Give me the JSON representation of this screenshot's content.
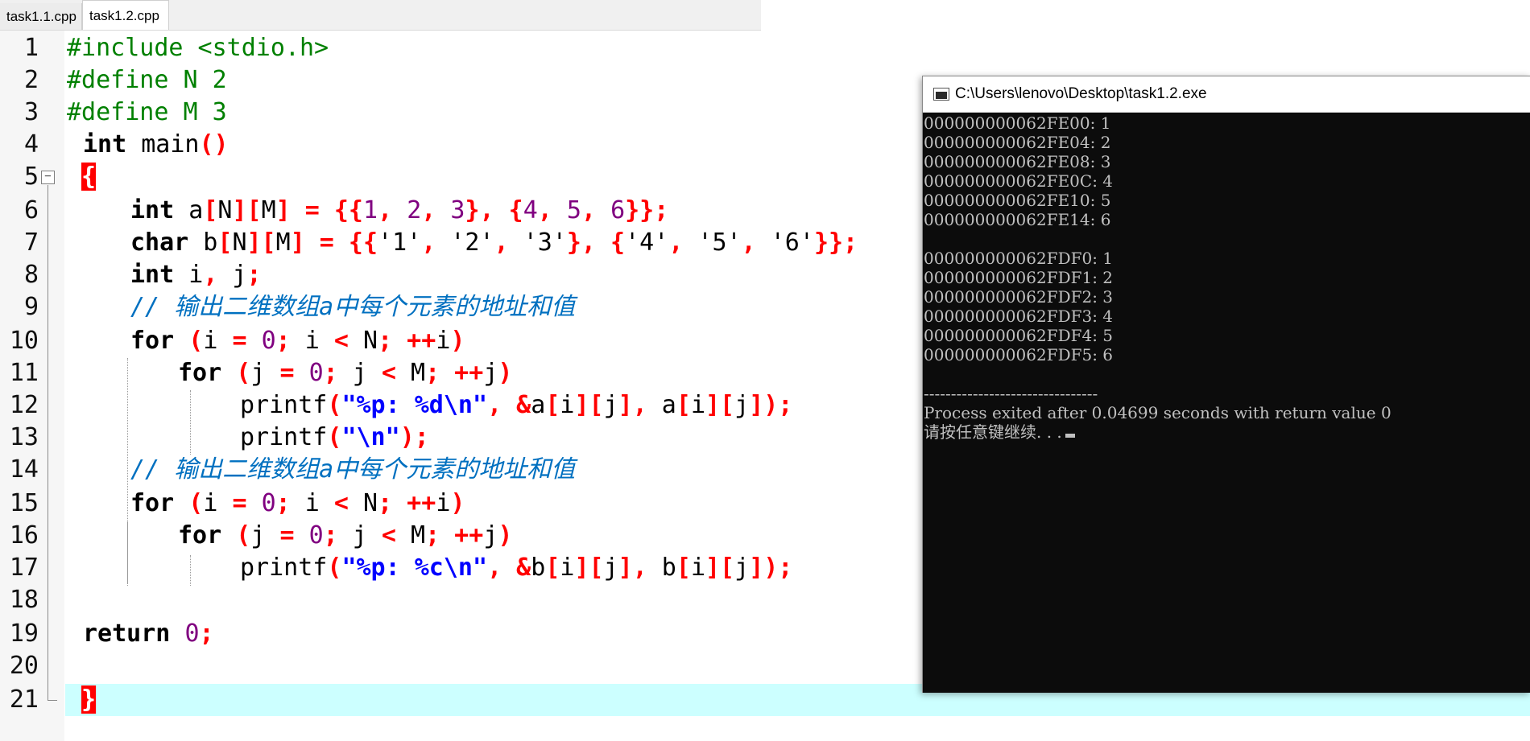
{
  "tabs": [
    {
      "label": "task1.1.cpp",
      "active": false
    },
    {
      "label": "task1.2.cpp",
      "active": true
    }
  ],
  "line_numbers": [
    "1",
    "2",
    "3",
    "4",
    "5",
    "6",
    "7",
    "8",
    "9",
    "10",
    "11",
    "12",
    "13",
    "14",
    "15",
    "16",
    "17",
    "18",
    "19",
    "20",
    "21"
  ],
  "code": {
    "l1_pp": "#include <stdio.h>",
    "l2_pp": "#define N 2",
    "l3_pp": "#define M 3",
    "l4_kw": "int",
    "l4_name": " main",
    "l4_paren": "()",
    "brace_open": "{",
    "l6_kw": "int",
    "l6_a": " a",
    "l6_b1": "[",
    "l6_n": "N",
    "l6_b2": "][",
    "l6_m": "M",
    "l6_b3": "]",
    "l6_eq": " = {{",
    "l6_v1": "1",
    "l6_c1": ", ",
    "l6_v2": "2",
    "l6_c2": ", ",
    "l6_v3": "3",
    "l6_mid": "}, {",
    "l6_v4": "4",
    "l6_c3": ", ",
    "l6_v5": "5",
    "l6_c4": ", ",
    "l6_v6": "6",
    "l6_end": "}};",
    "l7_kw": "char",
    "l7_b": " b",
    "l7_s1": "[",
    "l7_n": "N",
    "l7_s2": "][",
    "l7_m": "M",
    "l7_s3": "]",
    "l7_eq": " = {{",
    "l7_v1": "'1'",
    "l7_c1": ", ",
    "l7_v2": "'2'",
    "l7_c2": ", ",
    "l7_v3": "'3'",
    "l7_mid": "}, {",
    "l7_v4": "'4'",
    "l7_c3": ", ",
    "l7_v5": "'5'",
    "l7_c4": ", ",
    "l7_v6": "'6'",
    "l7_end": "}};",
    "l8_kw": "int",
    "l8_i": " i",
    "l8_c": ",",
    "l8_j": " j",
    "l8_sc": ";",
    "comment": "// 输出二维数组a中每个元素的地址和值",
    "for_kw": "for",
    "l10_open": " (",
    "l10_i": "i ",
    "l10_eq": "=",
    "l10_sp": " ",
    "l10_zero": "0",
    "l10_sc1": ";",
    "l10_i2": " i ",
    "l10_lt": "<",
    "l10_n": " N",
    "l10_sc2": "; ++",
    "l10_i3": "i",
    "l10_close": ")",
    "l11_open": " (",
    "l11_j": "j ",
    "l11_eq": "=",
    "l11_zero": "0",
    "l11_sc1": ";",
    "l11_j2": " j ",
    "l11_lt": "<",
    "l11_m": " M",
    "l11_sc2": "; ++",
    "l11_j3": "j",
    "l11_close": ")",
    "printf": "printf",
    "l12_open": "(",
    "l12_str": "\"%p: %d\\n\"",
    "l12_c1": ", &",
    "l12_a": "a",
    "l12_b1": "[",
    "l12_i": "i",
    "l12_b2": "][",
    "l12_j": "j",
    "l12_b3": "]",
    "l12_c2": ",",
    "l12_a2": " a",
    "l12_b4": "[",
    "l12_i2": "i",
    "l12_b5": "][",
    "l12_j2": "j",
    "l12_b6": "]);",
    "l13_open": "(",
    "l13_str": "\"\\n\"",
    "l13_close": ");",
    "l17_str": "\"%p: %c\\n\"",
    "l17_b": "b",
    "l17_b2": " b",
    "return_kw": "return",
    "l19_zero": "0",
    "l19_sc": ";",
    "brace_close": "}"
  },
  "console": {
    "title": "C:\\Users\\lenovo\\Desktop\\task1.2.exe",
    "lines": [
      "000000000062FE00: 1",
      "000000000062FE04: 2",
      "000000000062FE08: 3",
      "000000000062FE0C: 4",
      "000000000062FE10: 5",
      "000000000062FE14: 6",
      "",
      "000000000062FDF0: 1",
      "000000000062FDF1: 2",
      "000000000062FDF2: 3",
      "000000000062FDF3: 4",
      "000000000062FDF4: 5",
      "000000000062FDF5: 6",
      "",
      "--------------------------------",
      "Process exited after 0.04699 seconds with return value 0",
      "请按任意键继续. . ."
    ]
  }
}
